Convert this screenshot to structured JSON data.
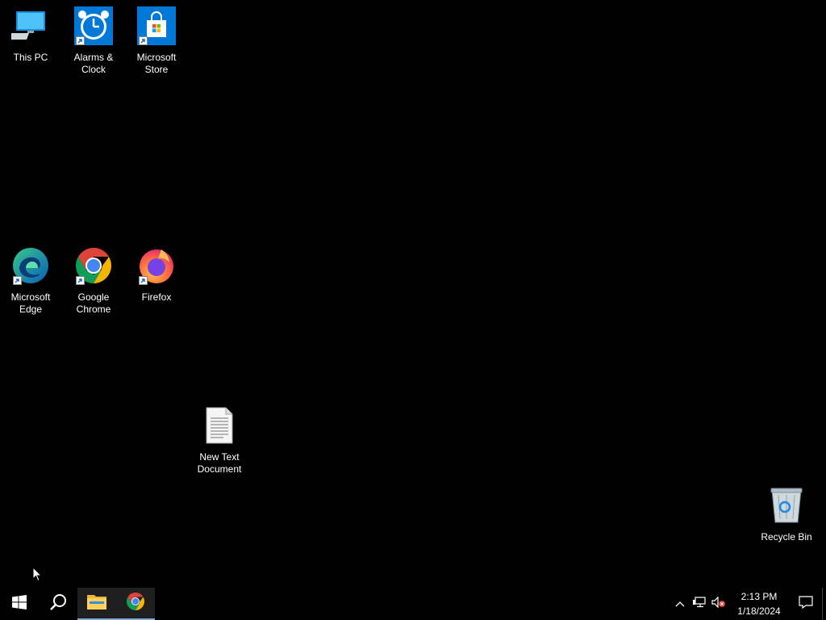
{
  "desktop": {
    "icons": [
      {
        "label": "This PC",
        "icon": "this-pc-icon"
      },
      {
        "label": "Alarms & Clock",
        "icon": "alarms-clock-icon"
      },
      {
        "label": "Microsoft Store",
        "icon": "microsoft-store-icon"
      },
      {
        "label": "Microsoft Edge",
        "icon": "microsoft-edge-icon"
      },
      {
        "label": "Google Chrome",
        "icon": "google-chrome-icon"
      },
      {
        "label": "Firefox",
        "icon": "firefox-icon"
      },
      {
        "label": "New Text Document",
        "icon": "text-document-icon"
      },
      {
        "label": "Recycle Bin",
        "icon": "recycle-bin-icon"
      }
    ]
  },
  "taskbar": {
    "start": "windows-start-icon",
    "search": "search-icon",
    "pinned": [
      "file-explorer-icon",
      "google-chrome-icon"
    ],
    "tray": {
      "icons": [
        "chevron-up-icon",
        "network-icon",
        "volume-muted-icon"
      ],
      "time": "2:13 PM",
      "date": "1/18/2024",
      "notifications": "action-center-icon"
    }
  },
  "colors": {
    "background": "#000000",
    "text": "#ffffff",
    "accent": "#0078d7"
  }
}
